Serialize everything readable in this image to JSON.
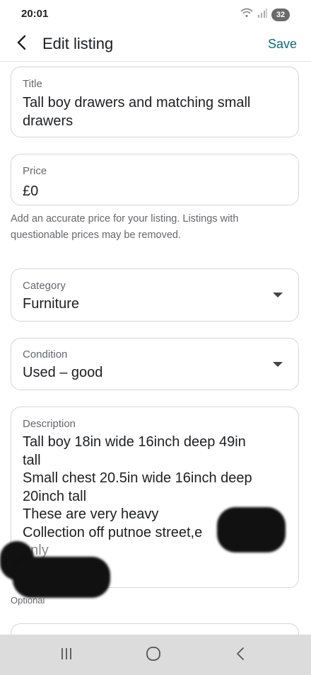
{
  "status_bar": {
    "time": "20:01",
    "battery": "32",
    "icons": [
      "wifi-icon",
      "signal-icon",
      "battery-icon"
    ]
  },
  "header": {
    "back_icon": "chevron-left-icon",
    "title": "Edit listing",
    "save_label": "Save"
  },
  "form": {
    "title": {
      "label": "Title",
      "lines": [
        "Tall boy drawers and matching small",
        "drawers"
      ]
    },
    "price": {
      "label": "Price",
      "value": "£0",
      "helper_lines": [
        "Add an accurate price for your listing. Listings with",
        "questionable prices may be removed."
      ]
    },
    "category": {
      "label": "Category",
      "value": "Furniture"
    },
    "condition": {
      "label": "Condition",
      "value": "Used – good"
    },
    "description": {
      "label": "Description",
      "lines": [
        "Tall boy 18in wide 16inch deep 49in",
        "tall",
        "Small chest 20.5in wide 16inch deep",
        "20inch tall",
        "These are very heavy",
        "Collection off putnoe street,e",
        "only"
      ],
      "optional_label": "Optional"
    }
  },
  "nav_bar": {
    "icons": [
      "recent-apps-icon",
      "home-icon",
      "back-icon"
    ]
  },
  "colors": {
    "accent": "#0a6b7c",
    "border": "#d4d6da",
    "label": "#65676b",
    "nav_bg": "#dcdcdc"
  }
}
